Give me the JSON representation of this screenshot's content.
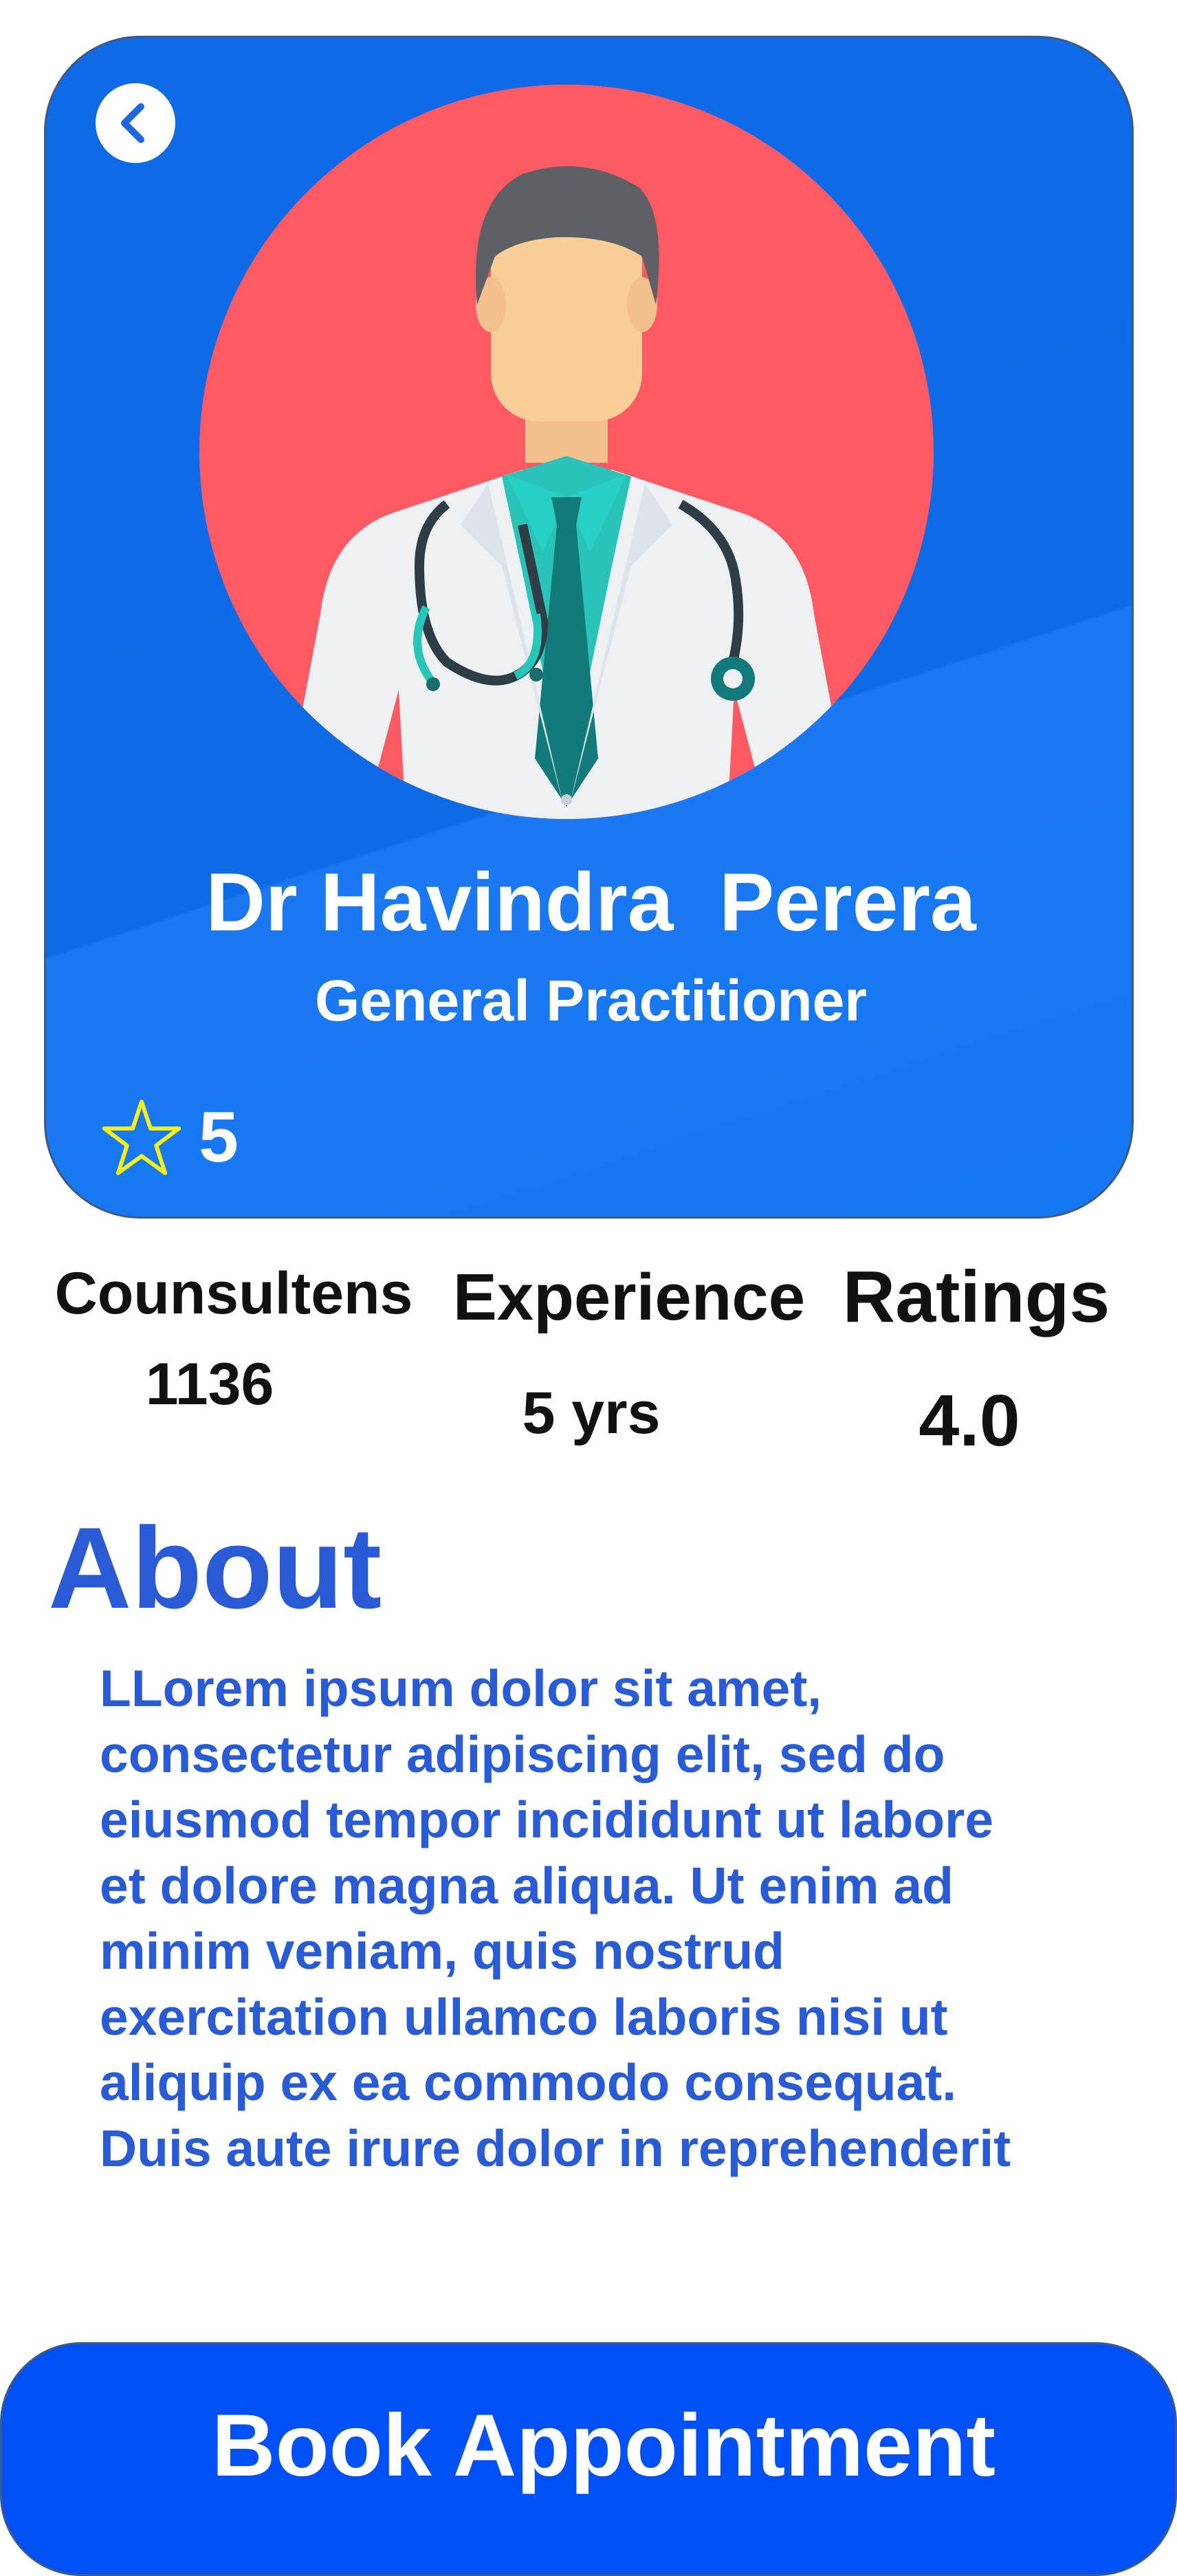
{
  "doctor": {
    "name": "Dr Havindra  Perera",
    "specialty": "General Practitioner",
    "rating": "5"
  },
  "stats": [
    {
      "label": "Counsultens",
      "value": "1136"
    },
    {
      "label": "Experience",
      "value": "5 yrs"
    },
    {
      "label": "Ratings",
      "value": "4.0"
    }
  ],
  "about": {
    "title": "About",
    "lines": [
      "LLorem ipsum dolor sit amet,",
      "consectetur adipiscing elit, sed do",
      "eiusmod tempor incididunt ut labore",
      "et dolore magna aliqua. Ut enim ad",
      "minim veniam, quis nostrud",
      "exercitation ullamco laboris nisi ut",
      "aliquip ex ea commodo consequat.",
      "Duis aute irure dolor in reprehenderit"
    ]
  },
  "actions": {
    "book_label": "Book Appointment"
  },
  "icons": {
    "back": "chevron-left-icon",
    "rating": "star-outline-icon"
  },
  "colors": {
    "card_blue": "#0f6ae8",
    "avatar_red": "#fd5a63",
    "accent_text": "#2a5bd7",
    "button_blue": "#004ff7",
    "star_yellow": "#f4f01a"
  }
}
